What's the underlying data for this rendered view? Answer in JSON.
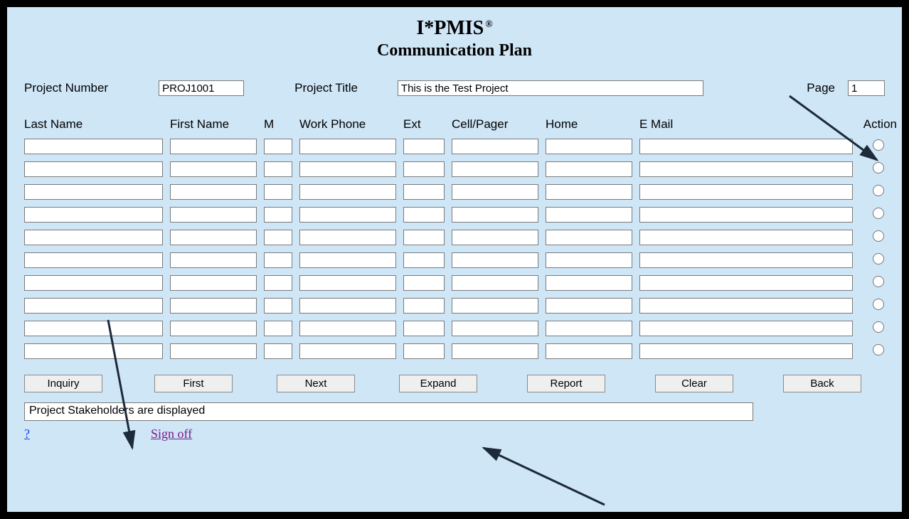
{
  "app": {
    "title_main": "I*PMIS",
    "title_reg": "®",
    "title_sub": "Communication Plan"
  },
  "header": {
    "project_number_label": "Project Number",
    "project_number_value": "PROJ1001",
    "project_title_label": "Project Title",
    "project_title_value": "This is the Test Project",
    "page_label": "Page",
    "page_value": "1"
  },
  "columns": {
    "last_name": "Last Name",
    "first_name": "First Name",
    "m": "M",
    "work_phone": "Work Phone",
    "ext": "Ext",
    "cell_pager": "Cell/Pager",
    "home": "Home",
    "email": "E Mail",
    "action": "Action"
  },
  "rows": [
    {
      "last": "",
      "first": "",
      "m": "",
      "work": "",
      "ext": "",
      "cell": "",
      "home": "",
      "email": ""
    },
    {
      "last": "",
      "first": "",
      "m": "",
      "work": "",
      "ext": "",
      "cell": "",
      "home": "",
      "email": ""
    },
    {
      "last": "",
      "first": "",
      "m": "",
      "work": "",
      "ext": "",
      "cell": "",
      "home": "",
      "email": ""
    },
    {
      "last": "",
      "first": "",
      "m": "",
      "work": "",
      "ext": "",
      "cell": "",
      "home": "",
      "email": ""
    },
    {
      "last": "",
      "first": "",
      "m": "",
      "work": "",
      "ext": "",
      "cell": "",
      "home": "",
      "email": ""
    },
    {
      "last": "",
      "first": "",
      "m": "",
      "work": "",
      "ext": "",
      "cell": "",
      "home": "",
      "email": ""
    },
    {
      "last": "",
      "first": "",
      "m": "",
      "work": "",
      "ext": "",
      "cell": "",
      "home": "",
      "email": ""
    },
    {
      "last": "",
      "first": "",
      "m": "",
      "work": "",
      "ext": "",
      "cell": "",
      "home": "",
      "email": ""
    },
    {
      "last": "",
      "first": "",
      "m": "",
      "work": "",
      "ext": "",
      "cell": "",
      "home": "",
      "email": ""
    },
    {
      "last": "",
      "first": "",
      "m": "",
      "work": "",
      "ext": "",
      "cell": "",
      "home": "",
      "email": ""
    }
  ],
  "buttons": {
    "inquiry": "Inquiry",
    "first": "First",
    "next": "Next",
    "expand": "Expand",
    "report": "Report",
    "clear": "Clear",
    "back": "Back"
  },
  "status": "Project Stakeholders are displayed",
  "footer": {
    "help": "?",
    "signoff": "Sign off"
  }
}
